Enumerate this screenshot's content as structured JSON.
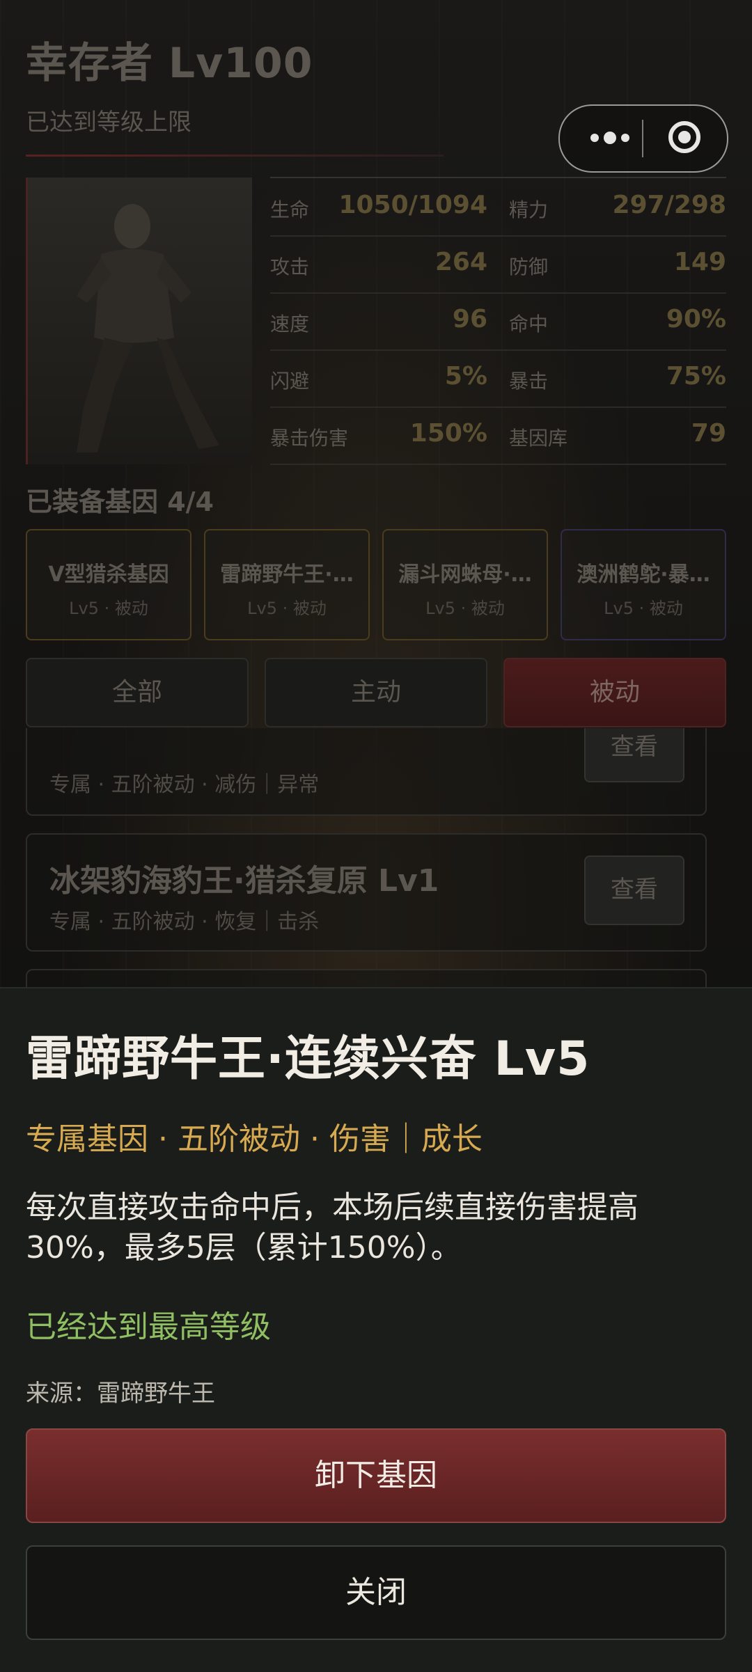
{
  "header": {
    "title": "幸存者 Lv100",
    "subtitle": "已达到等级上限"
  },
  "stats": [
    {
      "label": "生命",
      "value": "1050/1094"
    },
    {
      "label": "精力",
      "value": "297/298"
    },
    {
      "label": "攻击",
      "value": "264"
    },
    {
      "label": "防御",
      "value": "149"
    },
    {
      "label": "速度",
      "value": "96"
    },
    {
      "label": "命中",
      "value": "90%"
    },
    {
      "label": "闪避",
      "value": "5%"
    },
    {
      "label": "暴击",
      "value": "75%"
    },
    {
      "label": "暴击伤害",
      "value": "150%"
    },
    {
      "label": "基因库",
      "value": "79"
    }
  ],
  "equipped": {
    "title": "已装备基因 4/4",
    "genes": [
      {
        "name": "V型猎杀基因",
        "sub": "Lv5 · 被动"
      },
      {
        "name": "雷蹄野牛王·…",
        "sub": "Lv5 · 被动"
      },
      {
        "name": "漏斗网蛛母·…",
        "sub": "Lv5 · 被动"
      },
      {
        "name": "澳洲鹤鸵·暴…",
        "sub": "Lv5 · 被动"
      }
    ]
  },
  "tabs": [
    "全部",
    "主动",
    "被动"
  ],
  "list": [
    {
      "title": "",
      "sub": "专属 · 五阶被动 · 减伤｜异常",
      "button": "查看"
    },
    {
      "title": "冰架豹海豹王·猎杀复原 Lv1",
      "sub": "专属 · 五阶被动 · 恢复｜击杀",
      "button": "查看"
    }
  ],
  "modal": {
    "title": "雷蹄野牛王·连续兴奋 Lv5",
    "tags": "专属基因 · 五阶被动 · 伤害｜成长",
    "description": "每次直接攻击命中后，本场后续直接伤害提高30%，最多5层（累计150%）。",
    "max_level": "已经达到最高等级",
    "source": "来源：雷蹄野牛王",
    "unload_button": "卸下基因",
    "close_button": "关闭"
  },
  "colors": {
    "accent_gold": "#d7aa52",
    "max_green": "#8fbf62",
    "danger_red": "#7a2e2e"
  }
}
